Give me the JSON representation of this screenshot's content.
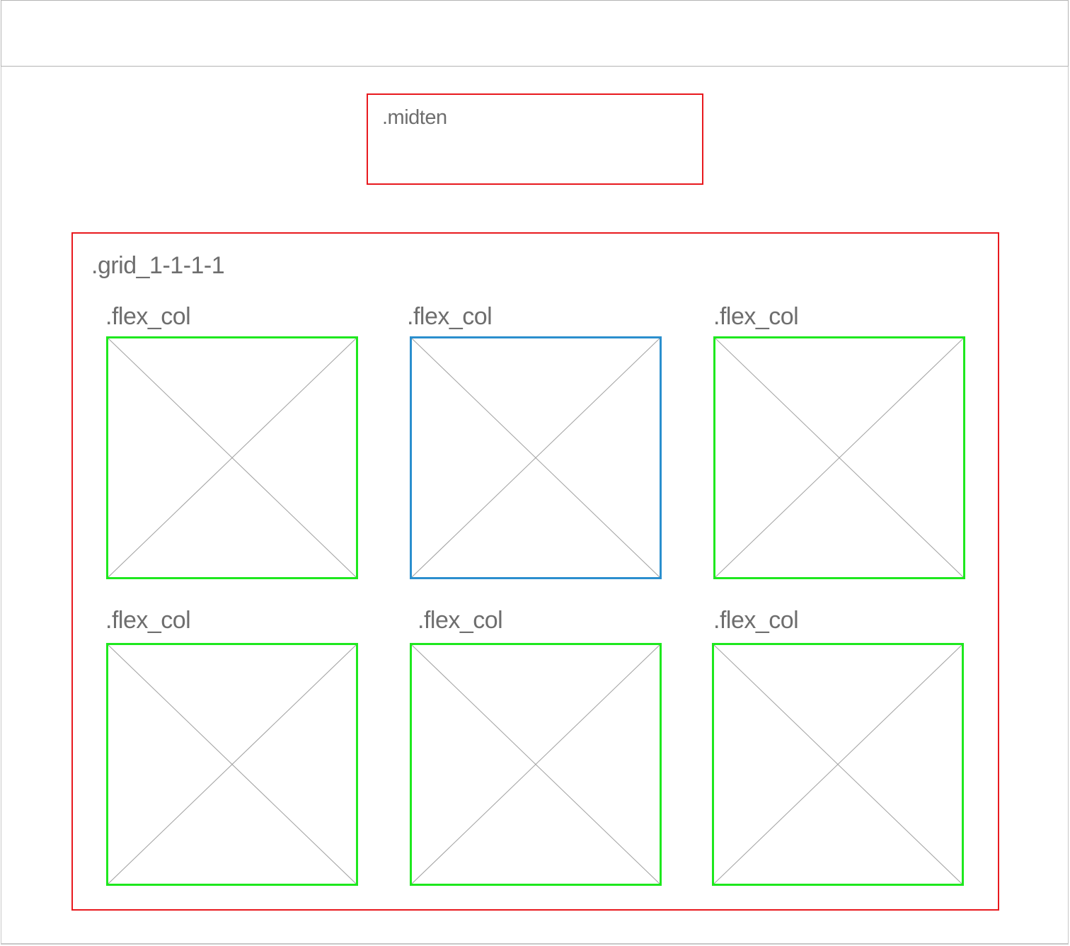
{
  "midten": {
    "label": ".midten",
    "border_color": "#e8191e"
  },
  "grid": {
    "label": ".grid_1-1-1-1",
    "border_color": "#e8191e",
    "columns": [
      {
        "label": ".flex_col",
        "border_color": "#1ee81e",
        "icon": "image-placeholder-icon"
      },
      {
        "label": ".flex_col",
        "border_color": "#2b8fce",
        "icon": "image-placeholder-icon"
      },
      {
        "label": ".flex_col",
        "border_color": "#1ee81e",
        "icon": "image-placeholder-icon"
      },
      {
        "label": ".flex_col",
        "border_color": "#1ee81e",
        "icon": "image-placeholder-icon"
      },
      {
        "label": ".flex_col",
        "border_color": "#1ee81e",
        "icon": "image-placeholder-icon"
      },
      {
        "label": ".flex_col",
        "border_color": "#1ee81e",
        "icon": "image-placeholder-icon"
      }
    ]
  },
  "colors": {
    "label_text": "#6e6e6e",
    "cross_line": "#a0a0a0",
    "header_border": "#b4b4b4"
  }
}
